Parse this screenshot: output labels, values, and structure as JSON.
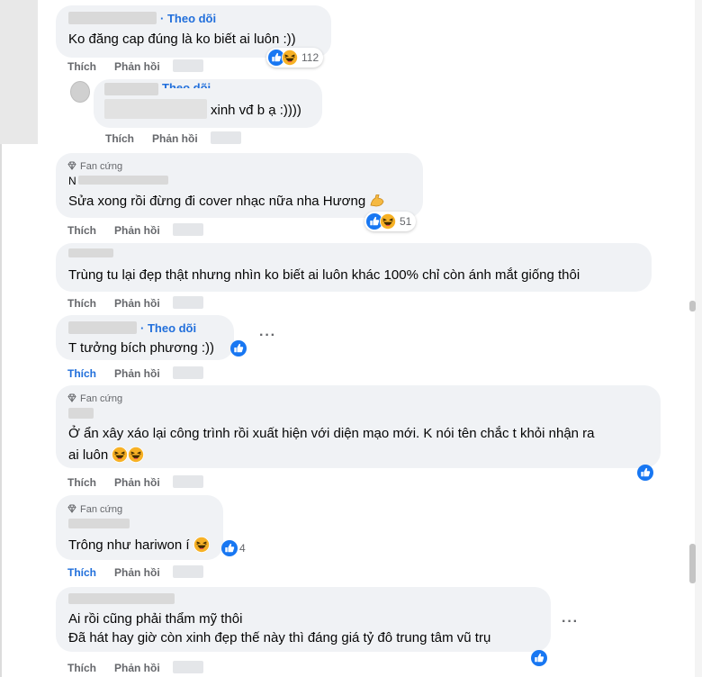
{
  "actions": {
    "like": "Thích",
    "reply": "Phản hồi"
  },
  "follow_label": "Theo dõi",
  "fan_badge": "Fan cứng",
  "comments": [
    {
      "text": "Ko đăng cap đúng là ko biết ai luôn :))",
      "reactions": "112"
    },
    {
      "text": "xinh vđ b ạ :))))",
      "follow_partial": "Theo dõi"
    },
    {
      "name": "N",
      "text": "Sửa xong rồi đừng đi cover nhạc nữa nha Hương",
      "reactions": "51"
    },
    {
      "text": "Trùng tu lại đẹp thật nhưng nhìn ko biết ai luôn khác 100% chỉ còn ánh mắt giống thôi"
    },
    {
      "text": "T tưởng bích phương :))"
    },
    {
      "lines": [
        "Ở ẩn xây xáo lại công trình rồi xuất hiện với diện mạo mới. K nói tên chắc t khỏi nhận ra",
        "ai luôn"
      ]
    },
    {
      "text": "Trông như hariwon í",
      "reactions": "4"
    },
    {
      "lines": [
        "Ai rồi cũng phải thẩm mỹ thôi",
        "Đã hát hay giờ còn xinh đẹp thế này thì đáng giá tỷ đô trung tâm vũ trụ"
      ]
    }
  ],
  "icons": {
    "like": "thumbs-up-icon",
    "haha": "laughing-emoji-icon",
    "flex": "flexed-biceps-icon",
    "fan": "diamond-icon",
    "more": "more-options-icon"
  },
  "colors": {
    "link": "#216fdb",
    "muted": "#65676b",
    "bubble": "#f0f2f5"
  }
}
